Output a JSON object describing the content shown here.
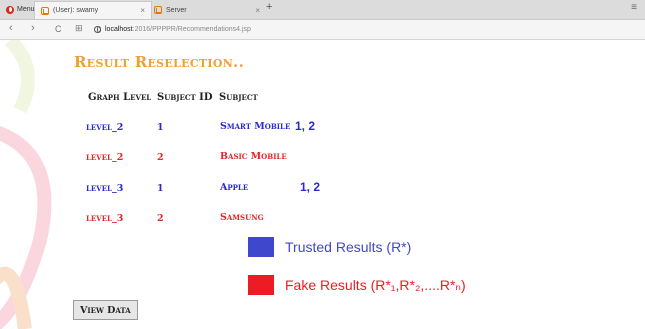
{
  "browser": {
    "menu_label": "Menu",
    "tabs": [
      {
        "title": "(User): swamy",
        "close": "×"
      },
      {
        "title": "Server",
        "close": "×"
      }
    ],
    "new_tab": "+",
    "nav": {
      "back": "‹",
      "forward": "›",
      "reload": "C",
      "speed_dial": "⊞"
    },
    "url_host": "localhost",
    "url_path": ":2016/PPPPR/Recommendations4.jsp"
  },
  "page": {
    "heading": "Result Reselection..",
    "columns": [
      "Graph Level",
      "Subject ID",
      "Subject"
    ],
    "rows": [
      {
        "level": "level_2",
        "subject_id": "1",
        "subject": "Smart Mobile",
        "ranks": "1, 2",
        "color": "#2a2ad0"
      },
      {
        "level": "level_2",
        "subject_id": "2",
        "subject": "Basic Mobile",
        "ranks": "",
        "color": "#e52424"
      },
      {
        "level": "level_3",
        "subject_id": "1",
        "subject": "Apple",
        "ranks": "1, 2",
        "color": "#2a2ad0"
      },
      {
        "level": "level_3",
        "subject_id": "2",
        "subject": "Samsung",
        "ranks": "",
        "color": "#e52424"
      }
    ],
    "legend": [
      {
        "label": "Trusted Results (R*)",
        "color": "#3f48cc"
      },
      {
        "label": "Fake Results (R*₁,R*₂,....R*ₙ)",
        "color": "#ed1c24"
      }
    ],
    "view_button": "View Data"
  }
}
